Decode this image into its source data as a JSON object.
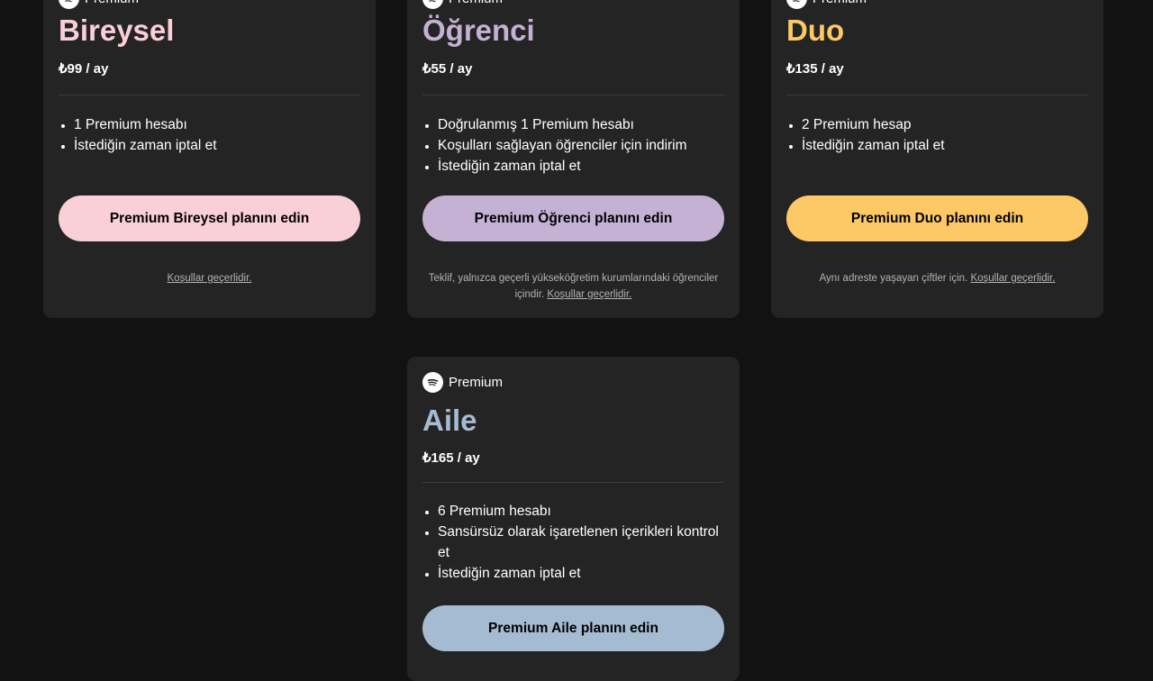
{
  "colors": {
    "background": "#121212",
    "card": "#242424",
    "bireysel": "#f9cfd8",
    "ogrenci": "#c4b1d4",
    "duo": "#fdc866",
    "aile": "#a5bbd1"
  },
  "brand_label": "Premium",
  "plans": [
    {
      "name": "Bireysel",
      "price": "₺99 / ay",
      "features": [
        "1 Premium hesabı",
        "İstediğin zaman iptal et"
      ],
      "cta": "Premium Bireysel planını edin",
      "terms_text": "",
      "terms_link": "Koşullar geçerlidir."
    },
    {
      "name": "Öğrenci",
      "price": "₺55 / ay",
      "features": [
        "Doğrulanmış 1 Premium hesabı",
        "Koşulları sağlayan öğrenciler için indirim",
        "İstediğin zaman iptal et"
      ],
      "cta": "Premium Öğrenci planını edin",
      "terms_text": "Teklif, yalnızca geçerli yükseköğretim kurumlarındaki öğrenciler içindir.",
      "terms_link": "Koşullar geçerlidir."
    },
    {
      "name": "Duo",
      "price": "₺135 / ay",
      "features": [
        "2 Premium hesap",
        "İstediğin zaman iptal et"
      ],
      "cta": "Premium Duo planını edin",
      "terms_text": "Aynı adreste yaşayan çiftler için.",
      "terms_link": "Koşullar geçerlidir."
    },
    {
      "name": "Aile",
      "price": "₺165 / ay",
      "features": [
        "6 Premium hesabı",
        "Sansürsüz olarak işaretlenen içerikleri kontrol et",
        "İstediğin zaman iptal et"
      ],
      "cta": "Premium Aile planını edin",
      "terms_text": "",
      "terms_link": ""
    }
  ]
}
